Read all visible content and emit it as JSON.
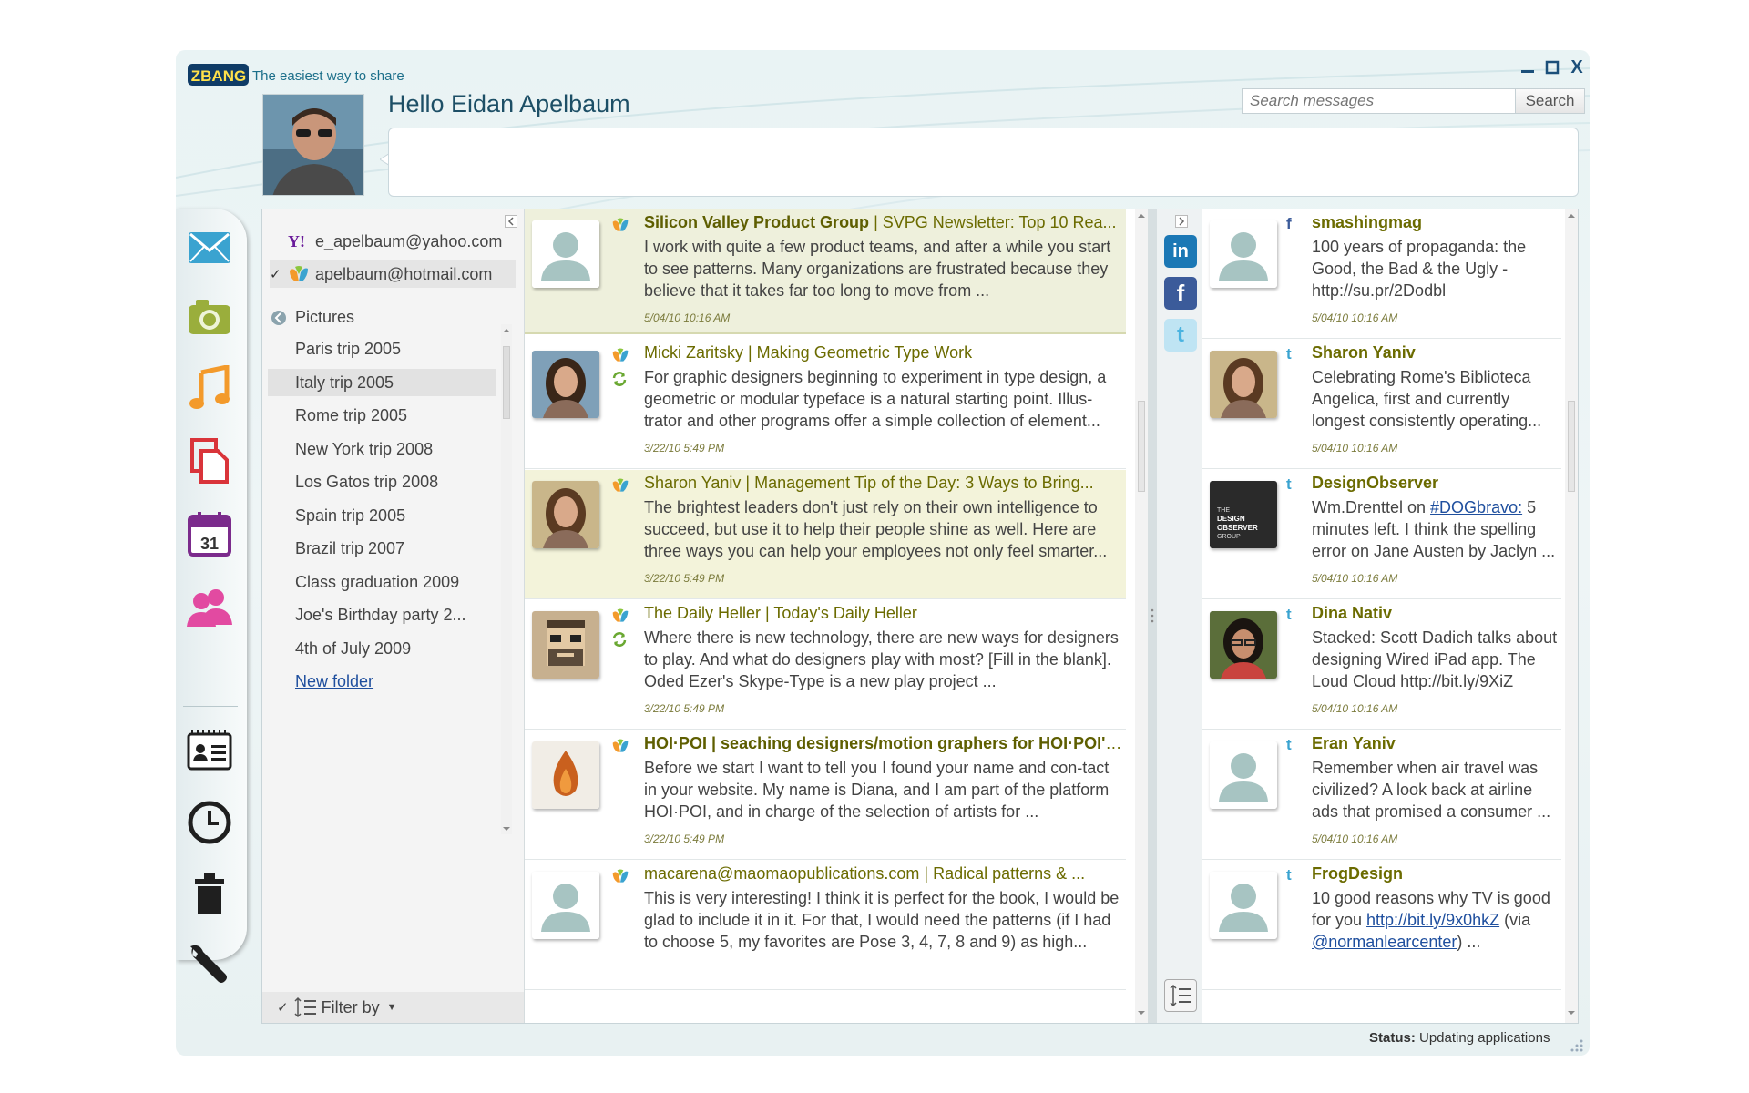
{
  "app": {
    "logo_text": "ZBANG",
    "tagline": "The easiest way to share",
    "greeting": "Hello Eidan Apelbaum"
  },
  "search": {
    "placeholder": "Search messages",
    "button_label": "Search"
  },
  "window_controls": {
    "minimize": "minimize-icon",
    "maximize": "maximize-icon",
    "close_label": "X"
  },
  "rail": {
    "icons": [
      "mail-icon",
      "camera-icon",
      "music-icon",
      "documents-icon",
      "calendar-icon",
      "contacts-icon",
      "contact-card-icon",
      "clock-icon",
      "trash-icon",
      "wrench-icon"
    ],
    "calendar_day": "31"
  },
  "accounts": [
    {
      "email": "e_apelbaum@yahoo.com",
      "checked": false,
      "provider": "yahoo-icon"
    },
    {
      "email": "apelbaum@hotmail.com",
      "checked": true,
      "provider": "hotmail-icon"
    }
  ],
  "folders": {
    "header": "Pictures",
    "items": [
      {
        "label": "Paris trip 2005",
        "expandable": false
      },
      {
        "label": "Italy trip 2005",
        "expandable": false,
        "selected": true
      },
      {
        "label": "Rome trip 2005",
        "expandable": true
      },
      {
        "label": "New York trip 2008",
        "expandable": false
      },
      {
        "label": "Los Gatos trip 2008",
        "expandable": false
      },
      {
        "label": "Spain trip 2005",
        "expandable": true
      },
      {
        "label": "Brazil trip 2007",
        "expandable": false
      },
      {
        "label": "Class graduation 2009",
        "expandable": false
      },
      {
        "label": "Joe's Birthday party 2...",
        "expandable": true
      },
      {
        "label": "4th of July 2009",
        "expandable": false
      }
    ],
    "new_folder": "New folder",
    "filter_label": "Filter by"
  },
  "messages": [
    {
      "sender": "Silicon Valley Product Group",
      "subject": " | SVPG Newsletter: Top 10 Rea...",
      "body": "I work with quite a few product teams, and after a while you start to see patterns.  Many organizations are frustrated because they believe that it takes far too long to move from ...",
      "time": "5/04/10 10:16 AM",
      "unread": true,
      "highlight": "selected"
    },
    {
      "sender": "Micki Zaritsky | Making Geometric Type Work",
      "subject": "",
      "body": "For graphic designers beginning to experiment in type design, a geometric or modular typeface is a natural starting point. Illus-trator and other programs offer a simple collection of element...",
      "time": "3/22/10 5:49 PM",
      "unread": false,
      "replied": true
    },
    {
      "sender": "Sharon Yaniv | Management Tip of the Day: 3 Ways to Bring...",
      "subject": "",
      "body": "The brightest leaders don't just rely on their own intelligence to succeed, but use it to help their people shine as well. Here are three ways you can help your employees not only feel smarter...",
      "time": "3/22/10 5:49 PM",
      "unread": false,
      "highlight": "hover"
    },
    {
      "sender": "The Daily Heller | Today's Daily Heller",
      "subject": "",
      "body": "Where there is new technology, there are new ways for designers to play. And what do designers play with most? [Fill in the blank]. Oded Ezer's Skype-Type is a new play project ...",
      "time": "3/22/10 5:49 PM",
      "unread": false,
      "replied": true
    },
    {
      "sender": "HOI·POI | seaching designers/motion graphers for HOI·POI's...",
      "subject": "",
      "body": "Before we start I want to tell you I found your name and con-tact in your website. My name is Diana, and I am part of the platform HOI·POI, and in charge of the selection of artists for ...",
      "time": "3/22/10 5:49 PM",
      "unread": true
    },
    {
      "sender": "macarena@maomaopublications.com | Radical patterns & ...",
      "subject": "",
      "body": "This is very interesting! I think it is perfect for the book, I would be glad to include it in it. For that, I would need the patterns (if I had to choose 5, my favorites are Pose 3, 4, 7, 8 and 9) as high...",
      "time": "",
      "unread": false
    }
  ],
  "social_networks": [
    "linkedin-icon",
    "facebook-icon",
    "twitter-icon"
  ],
  "feed": [
    {
      "network": "facebook",
      "name": "smashingmag",
      "body": "100 years of propaganda: the Good, the Bad & the Ugly - http://su.pr/2Dodbl",
      "time": "5/04/10 10:16 AM"
    },
    {
      "network": "twitter",
      "name": "Sharon Yaniv",
      "body": "Celebrating Rome's Biblioteca Angelica, first and currently longest consistently operating...",
      "time": "5/04/10 10:16 AM"
    },
    {
      "network": "twitter",
      "name": "DesignObserver",
      "body_pre": "Wm.Drenttel on ",
      "link": "#DOGbravo:",
      "body_post": " 5 minutes left. I think the spelling error on Jane Austen by Jaclyn ...",
      "time": "5/04/10 10:16 AM",
      "logo_text": "THE DESIGN OBSERVER GROUP"
    },
    {
      "network": "twitter",
      "name": "Dina Nativ",
      "body": "Stacked: Scott Dadich talks about designing Wired iPad app. The Loud Cloud http://bit.ly/9XiZ",
      "time": "5/04/10 10:16 AM"
    },
    {
      "network": "twitter",
      "name": "Eran Yaniv",
      "body": "Remember when air travel was civilized? A look back at airline ads that promised a consumer ...",
      "time": "5/04/10 10:16 AM"
    },
    {
      "network": "twitter",
      "name": "FrogDesign",
      "body_pre": "10 good reasons why TV is good for you ",
      "link": "http://bit.ly/9x0hkZ",
      "body_mid": " (via ",
      "link2": "@normanlearcenter",
      "body_post": ")  ...",
      "time": ""
    }
  ],
  "status": {
    "label": "Status:",
    "value": " Updating applications"
  },
  "colors": {
    "accent_teal": "#1d4f66",
    "sender_olive": "#6b6b00",
    "highlight_bg": "#f2f2dc",
    "link_blue": "#1f4f9e"
  }
}
